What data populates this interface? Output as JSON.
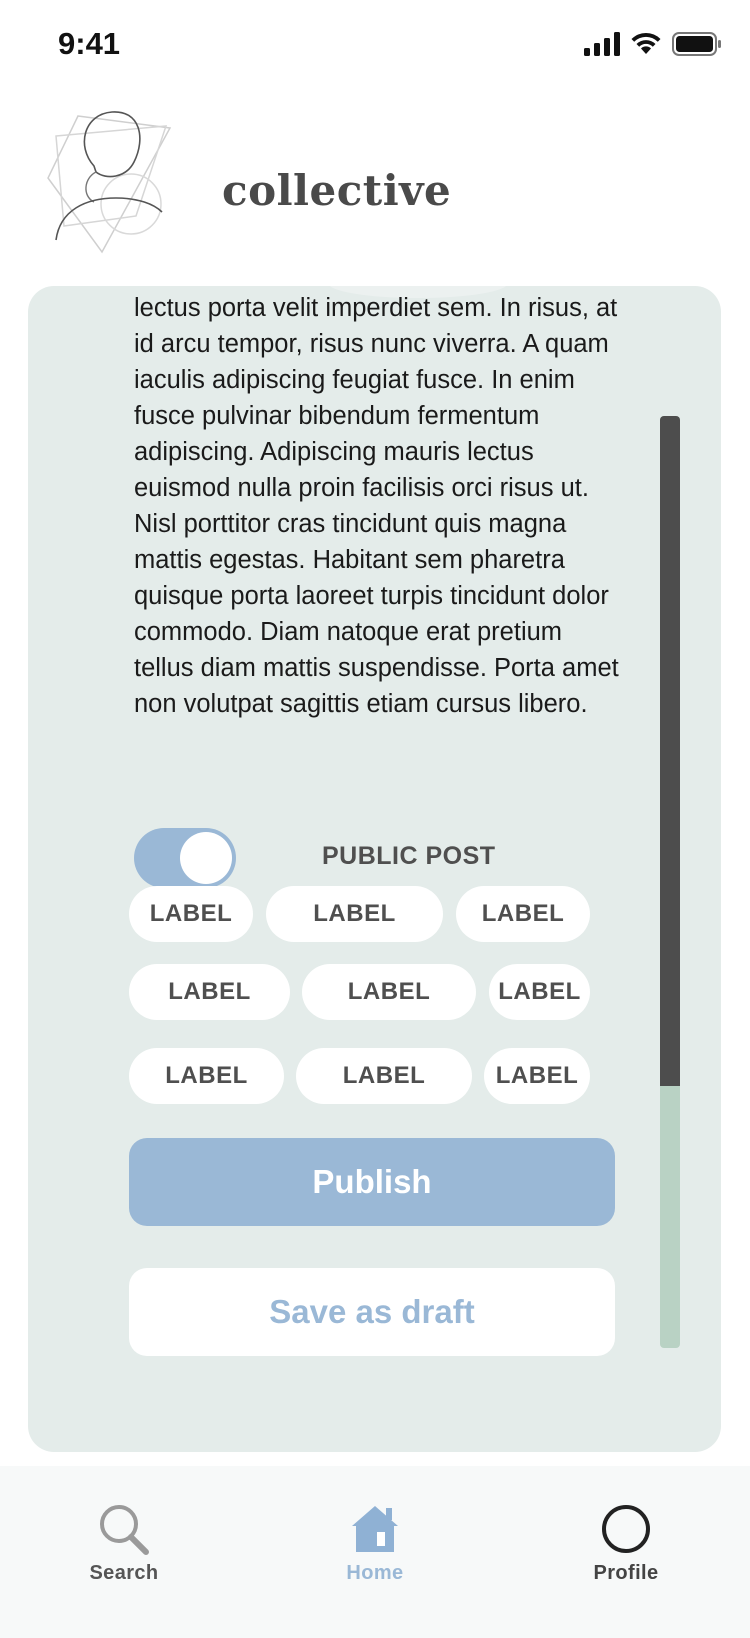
{
  "status_bar": {
    "time": "9:41",
    "icons": [
      "signal-icon",
      "wifi-icon",
      "battery-icon"
    ]
  },
  "header": {
    "brand": "collective",
    "logo": "sketch-portrait-logo"
  },
  "post": {
    "body": "lectus porta velit imperdiet sem. In risus, at id arcu tempor, risus nunc viverra. A quam iaculis adipiscing feugiat fusce. In enim fusce pulvinar bibendum fermentum adipiscing. Adipiscing mauris lectus euismod nulla proin facilisis orci risus ut. Nisl porttitor cras tincidunt quis magna mattis egestas. Habitant sem pharetra quisque porta laoreet turpis tincidunt dolor commodo. Diam natoque erat pretium tellus diam mattis suspendisse. Porta amet non volutpat sagittis etiam cursus libero.",
    "public_toggle": {
      "label": "PUBLIC POST",
      "on": true
    },
    "labels": [
      "LABEL",
      "LABEL",
      "LABEL",
      "LABEL",
      "LABEL",
      "LABEL",
      "LABEL",
      "LABEL",
      "LABEL"
    ],
    "publish_label": "Publish",
    "draft_label": "Save as draft",
    "scroll_position": 0.72
  },
  "tab_bar": {
    "tabs": [
      {
        "label": "Search",
        "icon": "search-icon",
        "active": false
      },
      {
        "label": "Home",
        "icon": "home-icon",
        "active": true
      },
      {
        "label": "Profile",
        "icon": "profile-icon",
        "active": false
      }
    ]
  },
  "colors": {
    "accent": "#9ab8d6",
    "card_background": "#e4ecea",
    "scroll_thumb": "#4d4d4d",
    "scroll_track": "#b9d2c4",
    "text_dark": "#4f4f4f"
  }
}
